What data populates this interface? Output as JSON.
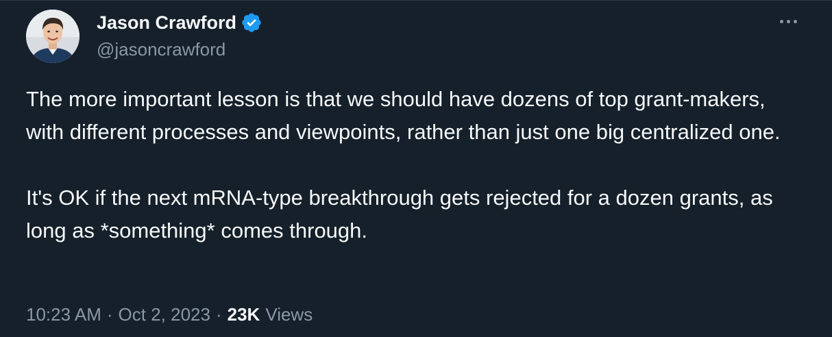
{
  "author": {
    "display_name": "Jason Crawford",
    "handle": "@jasoncrawford",
    "verified": true,
    "avatar_icon": "avatar-photo"
  },
  "tweet": {
    "paragraphs": [
      "The more important lesson is that we should have dozens of top grant-makers, with different processes and viewpoints, rather than just one big centralized one.",
      "It's OK if the next mRNA-type breakthrough gets rejected for a dozen grants, as long as *something* comes through."
    ]
  },
  "meta": {
    "time": "10:23 AM",
    "separator": "·",
    "date": "Oct 2, 2023",
    "views_count": "23K",
    "views_label": "Views"
  },
  "colors": {
    "background": "#15202b",
    "text_primary": "#f7f9f9",
    "text_secondary": "#8b98a5",
    "verified_badge": "#1d9bf0"
  },
  "icons": {
    "verified": "verified-badge-icon",
    "more": "more-options-icon"
  }
}
